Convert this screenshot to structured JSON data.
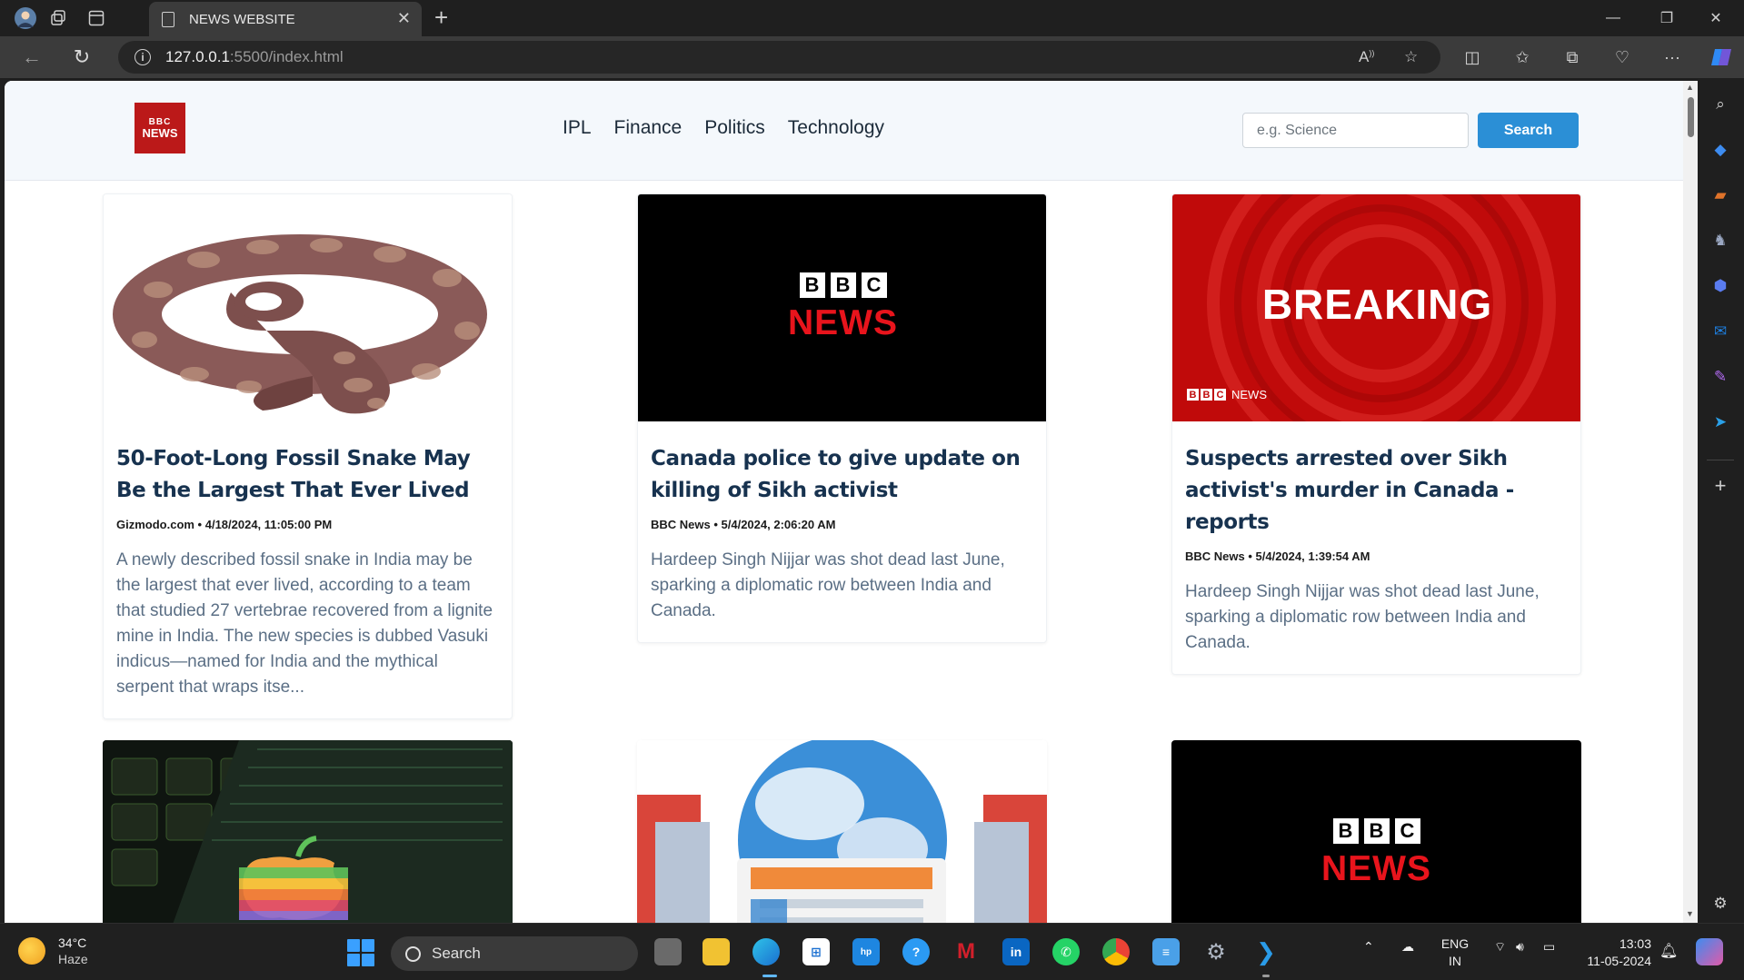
{
  "browser": {
    "tab_title": "NEWS WEBSITE",
    "url_host": "127.0.0.1",
    "url_path": ":5500/index.html"
  },
  "site": {
    "logo_line1": "BBC",
    "logo_line2": "NEWS",
    "nav": [
      "IPL",
      "Finance",
      "Politics",
      "Technology"
    ],
    "search_placeholder": "e.g. Science",
    "search_button": "Search"
  },
  "cards": [
    {
      "image": "fossil-snake",
      "title": "50-Foot-Long Fossil Snake May Be the Largest That Ever Lived",
      "meta": "Gizmodo.com • 4/18/2024, 11:05:00 PM",
      "desc": "A newly described fossil snake in India may be the largest that ever lived, according to a team that studied 27 vertebrae recovered from a lignite mine in India. The new species is dubbed Vasuki indicus—named for India and the mythical serpent that wraps itse..."
    },
    {
      "image": "bbc-news-black",
      "title": "Canada police to give update on killing of Sikh activist",
      "meta": "BBC News • 5/4/2024, 2:06:20 AM",
      "desc": "Hardeep Singh Nijjar was shot dead last June, sparking a diplomatic row between India and Canada."
    },
    {
      "image": "bbc-breaking-red",
      "title": "Suspects arrested over Sikh activist's murder in Canada - reports",
      "meta": "BBC News • 5/4/2024, 1:39:54 AM",
      "desc": "Hardeep Singh Nijjar was shot dead last June, sparking a diplomatic row between India and Canada."
    }
  ],
  "image_text": {
    "bbc_letters": [
      "B",
      "B",
      "C"
    ],
    "news_word": "NEWS",
    "breaking_word": "BREAKING",
    "breaking_footer_news": "NEWS"
  },
  "taskbar": {
    "weather_temp": "34°C",
    "weather_cond": "Haze",
    "search_label": "Search",
    "lang_line1": "ENG",
    "lang_line2": "IN",
    "time": "13:03",
    "date": "11-05-2024"
  },
  "colors": {
    "bbc_red": "#bb1919",
    "accent_blue": "#2b8fd6",
    "title_navy": "#17324f"
  }
}
